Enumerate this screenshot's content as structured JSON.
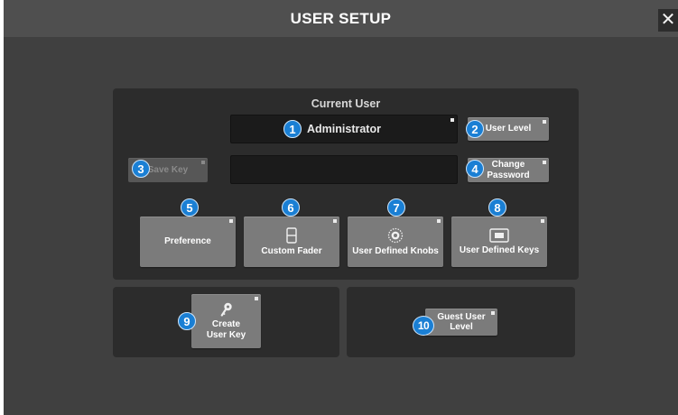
{
  "window": {
    "title": "USER SETUP",
    "close_label": "✕"
  },
  "current_user": {
    "heading": "Current User",
    "name": "Administrator",
    "user_level_label": "User Level",
    "save_key_label": "Save Key",
    "password_value": "",
    "change_password_label": [
      "Change",
      "Password"
    ]
  },
  "functions": {
    "preference_label": "Preference",
    "custom_fader_label": "Custom Fader",
    "user_defined_knobs_label": "User Defined Knobs",
    "user_defined_keys_label": "User Defined Keys"
  },
  "bottom": {
    "create_user_key_label": [
      "Create",
      "User Key"
    ],
    "guest_user_level_label": [
      "Guest User",
      "Level"
    ]
  },
  "callouts": [
    "1",
    "2",
    "3",
    "4",
    "5",
    "6",
    "7",
    "8",
    "9",
    "10"
  ],
  "colors": {
    "background": "#404040",
    "titlebar": "#4f4f4f",
    "panel": "#2c2c2c",
    "button": "#7b7b7b",
    "callout": "#1a7fd4"
  },
  "icons": {
    "close": "close-icon",
    "custom_fader": "fader-icon",
    "knobs": "knob-icon",
    "keys": "keys-icon",
    "create_key": "key-icon"
  }
}
